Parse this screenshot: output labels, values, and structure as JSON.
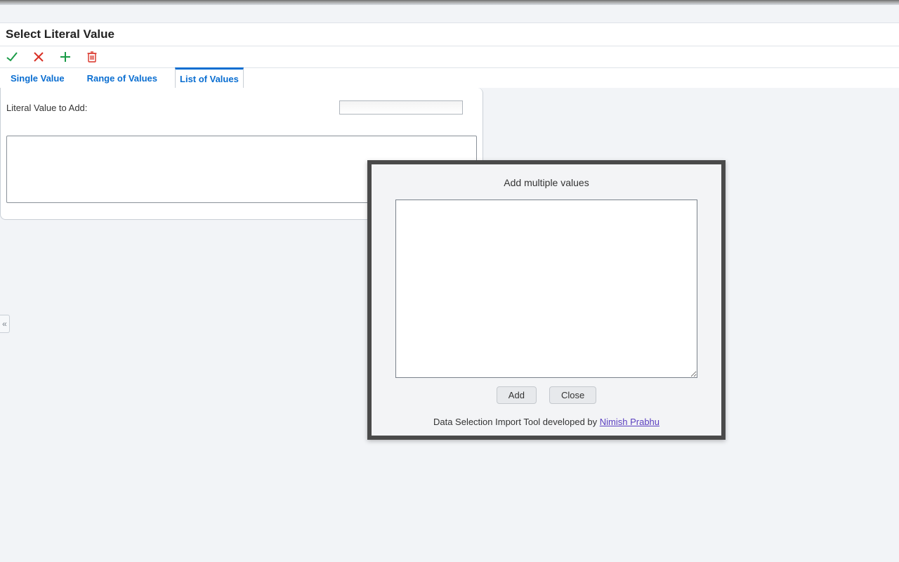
{
  "header": {
    "title": "Select Literal Value"
  },
  "tabs": [
    {
      "label": "Single Value",
      "active": false
    },
    {
      "label": "Range of Values",
      "active": false
    },
    {
      "label": "List of Values",
      "active": true
    }
  ],
  "form": {
    "literal_label": "Literal Value to Add:",
    "literal_value": ""
  },
  "side_collapse_glyph": "«",
  "modal": {
    "title": "Add multiple values",
    "textarea_value": "",
    "add_label": "Add",
    "close_label": "Close",
    "footer_text": "Data Selection Import Tool developed by ",
    "footer_link_text": "Nimish Prabhu"
  }
}
